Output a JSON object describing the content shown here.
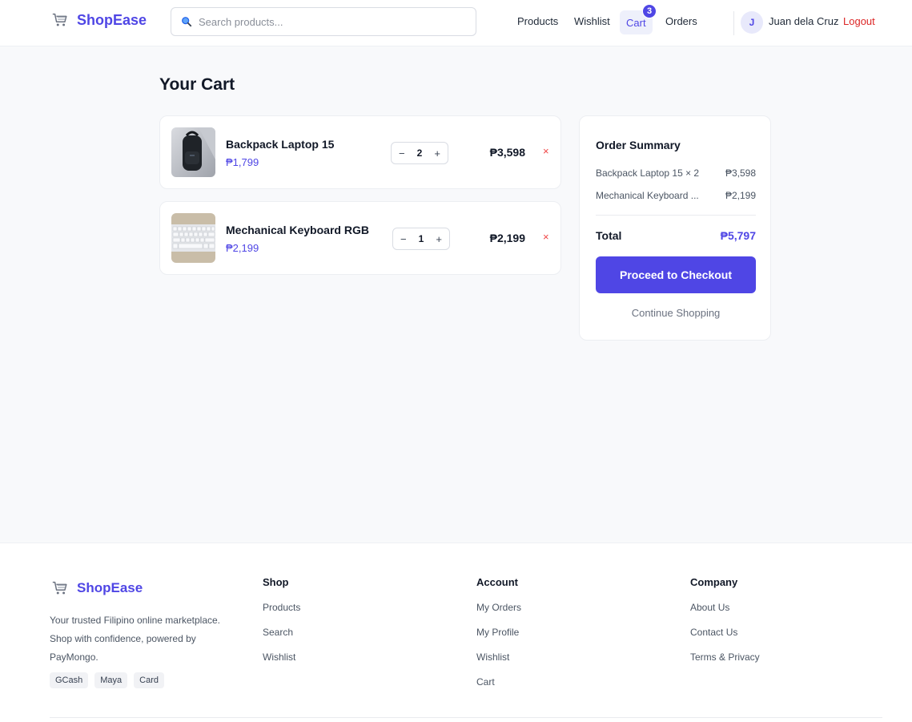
{
  "brand": {
    "name": "ShopEase",
    "accent": "#4f46e5"
  },
  "search": {
    "placeholder": "Search products..."
  },
  "nav": {
    "products": "Products",
    "wishlist": "Wishlist",
    "cart": "Cart",
    "cart_count": "3",
    "orders": "Orders",
    "user_initial": "J",
    "user_name": "Juan dela Cruz",
    "logout": "Logout"
  },
  "page": {
    "title": "Your Cart"
  },
  "cart": {
    "items": [
      {
        "name": "Backpack Laptop 15",
        "unit_price": "₱1,799",
        "quantity": "2",
        "subtotal": "₱3,598",
        "minus": "−",
        "plus": "+",
        "remove": "×",
        "thumb_icon": "backpack-photo"
      },
      {
        "name": "Mechanical Keyboard RGB",
        "unit_price": "₱2,199",
        "quantity": "1",
        "subtotal": "₱2,199",
        "minus": "−",
        "plus": "+",
        "remove": "×",
        "thumb_icon": "keyboard-photo"
      }
    ]
  },
  "summary": {
    "title": "Order Summary",
    "lines": [
      {
        "label": "Backpack Laptop 15 × 2",
        "amount": "₱3,598"
      },
      {
        "label": "Mechanical Keyboard ...",
        "amount": "₱2,199"
      }
    ],
    "total_label": "Total",
    "total_amount": "₱5,797",
    "checkout_label": "Proceed to Checkout",
    "continue_label": "Continue Shopping"
  },
  "footer": {
    "brand": "ShopEase",
    "tagline": "Your trusted Filipino online marketplace. Shop with confidence, powered by PayMongo.",
    "payment_badges": [
      "GCash",
      "Maya",
      "Card"
    ],
    "columns": [
      {
        "title": "Shop",
        "links": [
          "Products",
          "Search",
          "Wishlist"
        ]
      },
      {
        "title": "Account",
        "links": [
          "My Orders",
          "My Profile",
          "Wishlist",
          "Cart"
        ]
      },
      {
        "title": "Company",
        "links": [
          "About Us",
          "Contact Us",
          "Terms & Privacy"
        ]
      }
    ]
  }
}
